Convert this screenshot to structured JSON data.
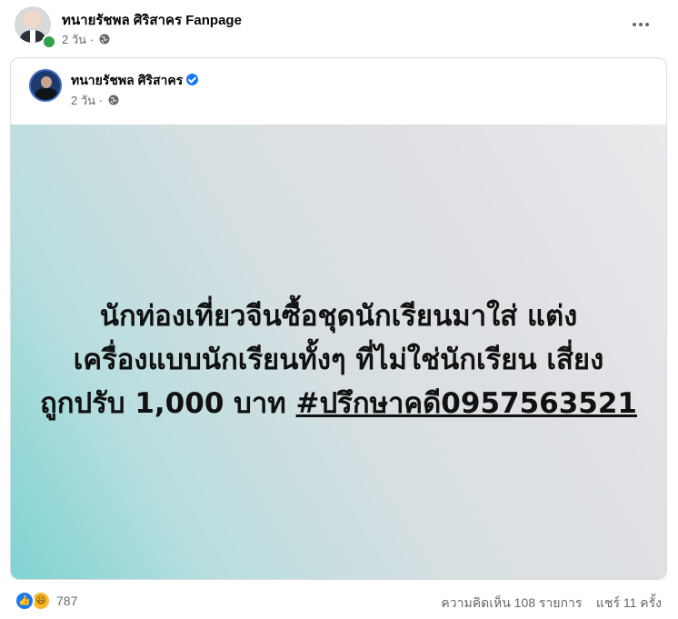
{
  "post": {
    "page_name": "ทนายรัชพล ศิริสาคร Fanpage",
    "time": "2 วัน",
    "privacy_icon": "globe-icon",
    "more_icon": "more-dots-icon"
  },
  "shared": {
    "author": "ทนายรัชพล ศิริสาคร",
    "verified_icon": "verified-badge-icon",
    "time": "2 วัน",
    "image_text_line1": "นักท่องเที่ยวจีนซื้อชุดนักเรียนมาใส่ แต่ง",
    "image_text_line2": "เครื่องแบบนักเรียนทั้งๆ ที่ไม่ใช่นักเรียน เสี่ยง",
    "image_text_line3_prefix": "ถูกปรับ 1,000 บาท",
    "hashtag": "#ปรึกษาคดี0957563521"
  },
  "reactions": {
    "count": "787",
    "icons": [
      "like-icon",
      "haha-icon"
    ],
    "comments": "ความคิดเห็น 108 รายการ",
    "shares": "แชร์ 11 ครั้ง"
  },
  "colors": {
    "accent": "#1877f2",
    "online": "#31a24c",
    "meta_text": "#65676b"
  }
}
